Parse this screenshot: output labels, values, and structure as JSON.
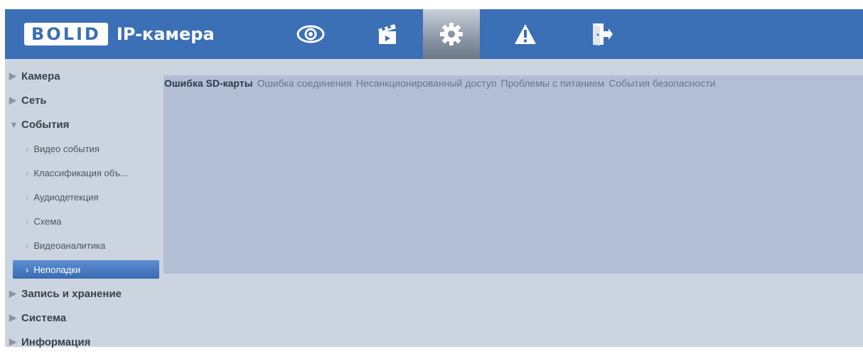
{
  "header": {
    "logo_text": "BOLID",
    "product_name": "IP-камера",
    "nav": [
      {
        "id": "live",
        "icon": "eye-icon"
      },
      {
        "id": "playback",
        "icon": "clapperboard-icon"
      },
      {
        "id": "settings",
        "icon": "gear-icon",
        "active": true
      },
      {
        "id": "alarm",
        "icon": "warning-icon"
      },
      {
        "id": "logout",
        "icon": "exit-icon"
      }
    ],
    "colors": {
      "bar": "#3b6fb6",
      "active_tab": "#8a96a6"
    }
  },
  "sidebar": {
    "items": [
      {
        "label": "Камера",
        "expanded": false
      },
      {
        "label": "Сеть",
        "expanded": false
      },
      {
        "label": "События",
        "expanded": true,
        "children": [
          {
            "label": "Видео события"
          },
          {
            "label": "Классификация объ..."
          },
          {
            "label": "Аудиодетекция"
          },
          {
            "label": "Схема"
          },
          {
            "label": "Видеоаналитика"
          },
          {
            "label": "Неполадки",
            "active": true
          }
        ]
      },
      {
        "label": "Запись и хранение",
        "expanded": false
      },
      {
        "label": "Система",
        "expanded": false
      },
      {
        "label": "Информация",
        "expanded": false
      }
    ]
  },
  "main": {
    "tabs": [
      {
        "label": "Ошибка SD-карты",
        "active": true
      },
      {
        "label": "Ошибка соединения"
      },
      {
        "label": "Несанкционированный доступ"
      },
      {
        "label": "Проблемы с питанием"
      },
      {
        "label": "События безопасности"
      }
    ]
  }
}
